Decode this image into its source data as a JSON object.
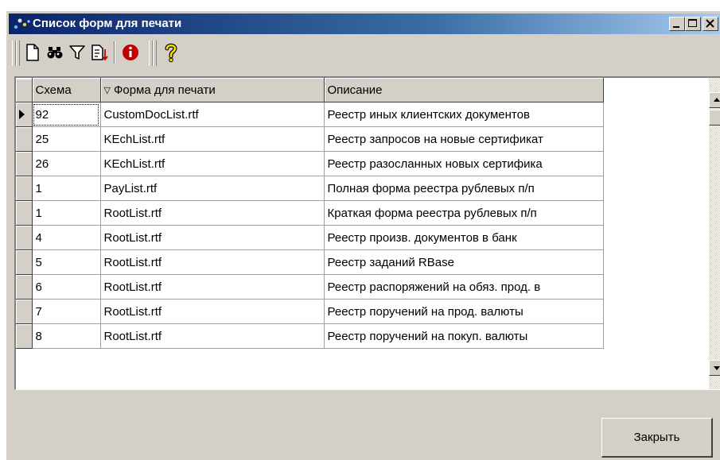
{
  "window": {
    "title": "Список форм для печати",
    "controls": [
      "minimize-icon",
      "maximize-icon",
      "close-icon"
    ]
  },
  "toolbar": {
    "tools": [
      "new-document-icon",
      "binoculars-icon",
      "filter-icon",
      "sort-icon",
      "info-icon",
      "help-icon"
    ]
  },
  "grid": {
    "columns": [
      "Схема",
      "Форма для печати",
      "Описание"
    ],
    "sorted_column_icon": "sort-down-triangle-icon",
    "rows": [
      {
        "scheme": "92",
        "form": "CustomDocList.rtf",
        "desc": "Реестр иных клиентских документов"
      },
      {
        "scheme": "25",
        "form": "KEchList.rtf",
        "desc": "Реестр запросов на новые сертификат"
      },
      {
        "scheme": "26",
        "form": "KEchList.rtf",
        "desc": "Реестр разосланных новых сертифика"
      },
      {
        "scheme": "1",
        "form": "PayList.rtf",
        "desc": "Полная форма реестра рублевых п/п"
      },
      {
        "scheme": "1",
        "form": "RootList.rtf",
        "desc": "Краткая форма реестра рублевых п/п"
      },
      {
        "scheme": "4",
        "form": "RootList.rtf",
        "desc": "Реестр произв. документов в банк"
      },
      {
        "scheme": "5",
        "form": "RootList.rtf",
        "desc": "Реестр заданий RBase"
      },
      {
        "scheme": "6",
        "form": "RootList.rtf",
        "desc": "Реестр распоряжений на обяз. прод. в"
      },
      {
        "scheme": "7",
        "form": "RootList.rtf",
        "desc": "Реестр поручений на прод. валюты"
      },
      {
        "scheme": "8",
        "form": "RootList.rtf",
        "desc": "Реестр поручений на покуп. валюты"
      }
    ]
  },
  "buttons": {
    "close_label": "Закрыть"
  },
  "colors": {
    "titlebar_start": "#0a246a",
    "titlebar_end": "#a6caf0",
    "face": "#d4d0c8"
  }
}
